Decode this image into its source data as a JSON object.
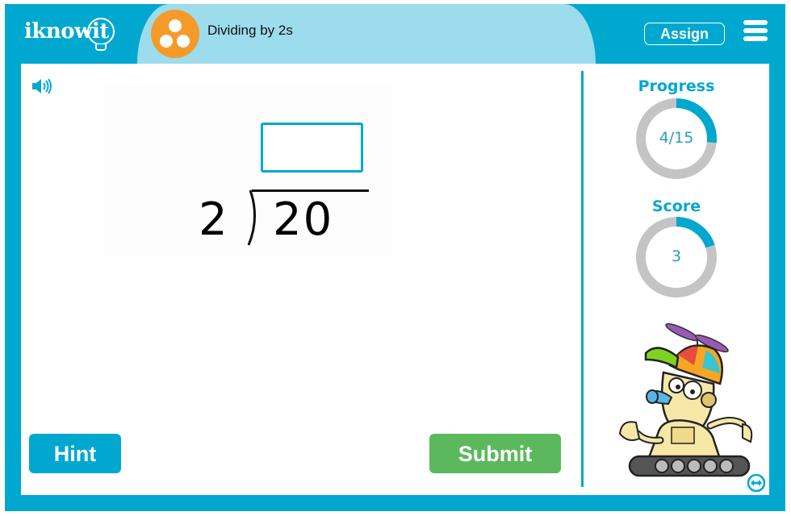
{
  "header": {
    "logo_text": "iknowit",
    "topic_title": "Dividing by 2s",
    "topic_icon": "three-dots-icon",
    "assign_label": "Assign",
    "menu_icon": "hamburger-menu-icon"
  },
  "colors": {
    "brand": "#00a8cf",
    "tab": "#9cdcec",
    "topic_icon": "#f59a29",
    "submit": "#5cb85c",
    "ring_track": "#c4c4c4"
  },
  "problem": {
    "audio_icon": "speaker-icon",
    "divisor": "2",
    "dividend": "20",
    "answer_value": "",
    "answer_placeholder": ""
  },
  "sidebar": {
    "progress": {
      "label": "Progress",
      "display": "4/15",
      "current": 4,
      "total": 15
    },
    "score": {
      "label": "Score",
      "display": "3",
      "fraction": 0.2
    },
    "mascot": "robot-mascot",
    "resize_icon": "resize-horizontal-icon"
  },
  "actions": {
    "hint_label": "Hint",
    "submit_label": "Submit"
  }
}
